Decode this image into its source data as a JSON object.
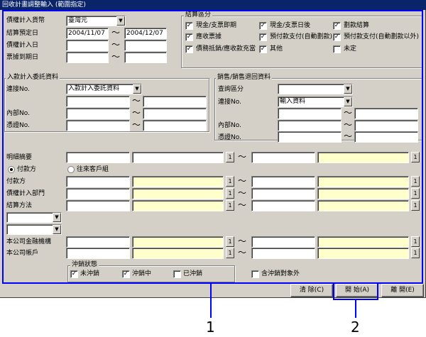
{
  "window": {
    "title": "回收計畫調整輸入 (範圍指定)"
  },
  "colors": {
    "annotation": "#0000ff",
    "title_bar": "#0a246a",
    "window_bg": "#d4d0c8",
    "highlight_field": "#ffffcc"
  },
  "header": {
    "currency_label": "債權計入貨幣",
    "currency_value": "臺灣元",
    "settle_date_label": "結算預定日",
    "settle_date_from": "2004/11/07",
    "settle_date_to": "2004/12/07",
    "debt_date_label": "債權計入日",
    "bill_due_label": "票據到期日",
    "tilde": "～"
  },
  "settlement": {
    "title": "結算區分",
    "options": [
      {
        "label": "現金/支票即期",
        "checked": true
      },
      {
        "label": "現金/支票日後",
        "checked": true
      },
      {
        "label": "劃款結算",
        "checked": true
      },
      {
        "label": "應收票據",
        "checked": true
      },
      {
        "label": "預付款支付(自動劃款)",
        "checked": true
      },
      {
        "label": "預付款支付(自動劃款以外)",
        "checked": true
      },
      {
        "label": "債務抵銷/應收款充當",
        "checked": true
      },
      {
        "label": "其他",
        "checked": true
      },
      {
        "label": "未定",
        "checked": false
      }
    ]
  },
  "inbound": {
    "title": "入款計入委託資料",
    "link_label": "連接No.",
    "link_value": "入款計入委託資料",
    "internal_label": "內部No.",
    "voucher_label": "憑證No."
  },
  "sales": {
    "title": "銷售/銷售退回資料",
    "query_label": "查詢區分",
    "link_label": "連接No.",
    "link_value": "輸入資料",
    "internal_label": "內部No.",
    "voucher_label": "憑證No."
  },
  "detail": {
    "summary_label": "明細摘要",
    "radio_payer": "付款方",
    "radio_trade": "往來客戶組",
    "payer_label": "付款方",
    "dept_label": "債權計入部門",
    "method_label": "結算方法",
    "bank_label": "本公司金融機構",
    "account_label": "本公司帳戶",
    "lookup_glyph": "1"
  },
  "clear_status": {
    "title": "沖銷狀態",
    "options": [
      {
        "label": "未沖銷",
        "checked": true
      },
      {
        "label": "沖銷中",
        "checked": true
      },
      {
        "label": "已沖銷",
        "checked": false
      }
    ],
    "include_target_label": "含沖銷對象外",
    "include_target_checked": false
  },
  "buttons": {
    "clear": "清 除(C)",
    "start": "開 始(A)",
    "exit": "離 開(E)"
  },
  "annotations": {
    "label1": "1",
    "label2": "2"
  }
}
